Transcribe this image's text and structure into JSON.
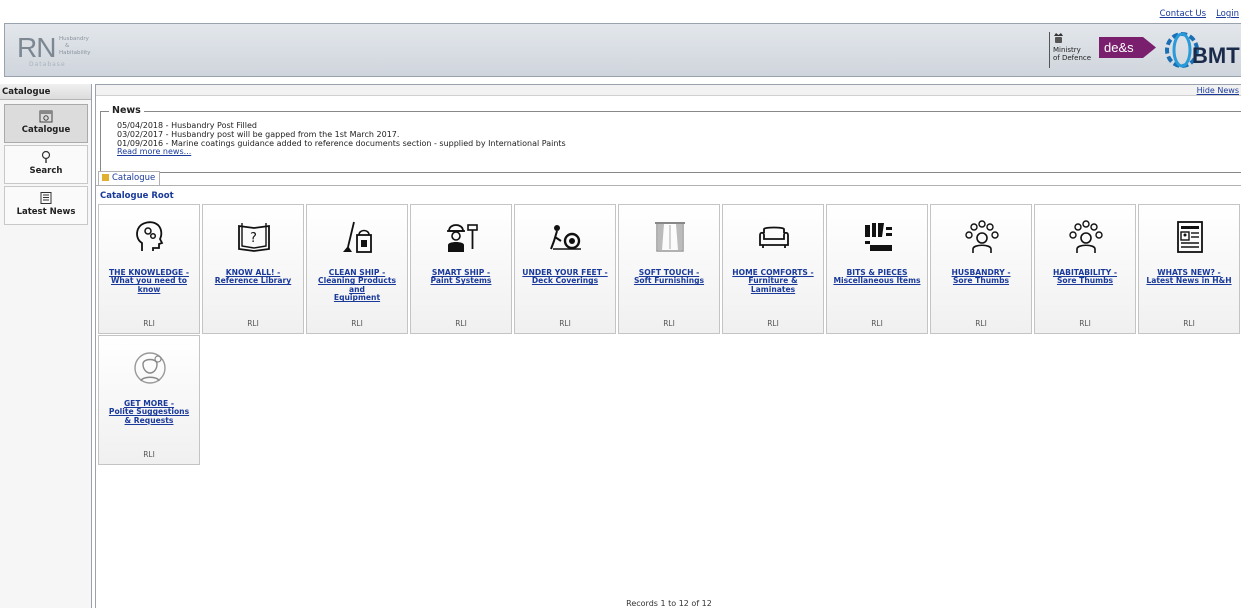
{
  "top_links": {
    "contact": "Contact Us",
    "login": "Login"
  },
  "logo": {
    "initials": "RN",
    "sub1": "Husbandry",
    "sub2": "&",
    "sub3": "Habitability",
    "sub4": "Database"
  },
  "partners": {
    "mod_line1": "Ministry",
    "mod_line2": "of Defence",
    "des": "de&s",
    "bmt": "BMT"
  },
  "sidebar": {
    "title": "Catalogue",
    "items": [
      {
        "label": "Catalogue",
        "icon": "catalogue-icon",
        "active": true
      },
      {
        "label": "Search",
        "icon": "search-icon",
        "active": false
      },
      {
        "label": "Latest News",
        "icon": "news-icon",
        "active": false
      }
    ]
  },
  "main": {
    "hide_news": "Hide News",
    "news": {
      "legend": "News",
      "lines": [
        "05/04/2018 - Husbandry Post Filled",
        "03/02/2017 - Husbandry post will be gapped from the 1st March 2017.",
        "01/09/2016 - Marine coatings guidance added to reference documents section - supplied by International Paints"
      ],
      "read_more": "Read more news..."
    },
    "tab": "Catalogue",
    "catalogue_root": "Catalogue Root",
    "tiles": [
      {
        "line1": "THE KNOWLEDGE -",
        "line2": "What you need to know",
        "line3": "",
        "tag": "RLI",
        "icon": "head-gears-icon"
      },
      {
        "line1": "KNOW ALL! -",
        "line2": "Reference Library",
        "line3": "",
        "tag": "RLI",
        "icon": "book-question-icon"
      },
      {
        "line1": "CLEAN SHIP -",
        "line2": "Cleaning Products and",
        "line3": "Equipment",
        "tag": "RLI",
        "icon": "mop-bucket-icon"
      },
      {
        "line1": "SMART SHIP -",
        "line2": "Paint Systems",
        "line3": "",
        "tag": "RLI",
        "icon": "painter-icon"
      },
      {
        "line1": "UNDER YOUR FEET -",
        "line2": "Deck Coverings",
        "line3": "",
        "tag": "RLI",
        "icon": "floor-roll-icon"
      },
      {
        "line1": "SOFT TOUCH -",
        "line2": "Soft Furnishings",
        "line3": "",
        "tag": "RLI",
        "icon": "curtains-icon"
      },
      {
        "line1": "HOME COMFORTS -",
        "line2": "Furniture & Laminates",
        "line3": "",
        "tag": "RLI",
        "icon": "sofa-icon"
      },
      {
        "line1": "BITS & PIECES",
        "line2": "Miscellaneous Items",
        "line3": "",
        "tag": "RLI",
        "icon": "parts-icon"
      },
      {
        "line1": "HUSBANDRY -",
        "line2": "Sore Thumbs",
        "line3": "",
        "tag": "RLI",
        "icon": "person-network-icon"
      },
      {
        "line1": "HABITABILITY -",
        "line2": "Sore Thumbs",
        "line3": "",
        "tag": "RLI",
        "icon": "person-network-icon"
      },
      {
        "line1": "WHATS NEW? -",
        "line2": "Latest News in H&H",
        "line3": "",
        "tag": "RLI",
        "icon": "newspaper-icon"
      },
      {
        "line1": "GET MORE -",
        "line2": "Polite Suggestions",
        "line3": "& Requests",
        "tag": "RLI",
        "icon": "thinking-person-icon"
      }
    ],
    "records": "Records 1 to 12 of 12"
  }
}
